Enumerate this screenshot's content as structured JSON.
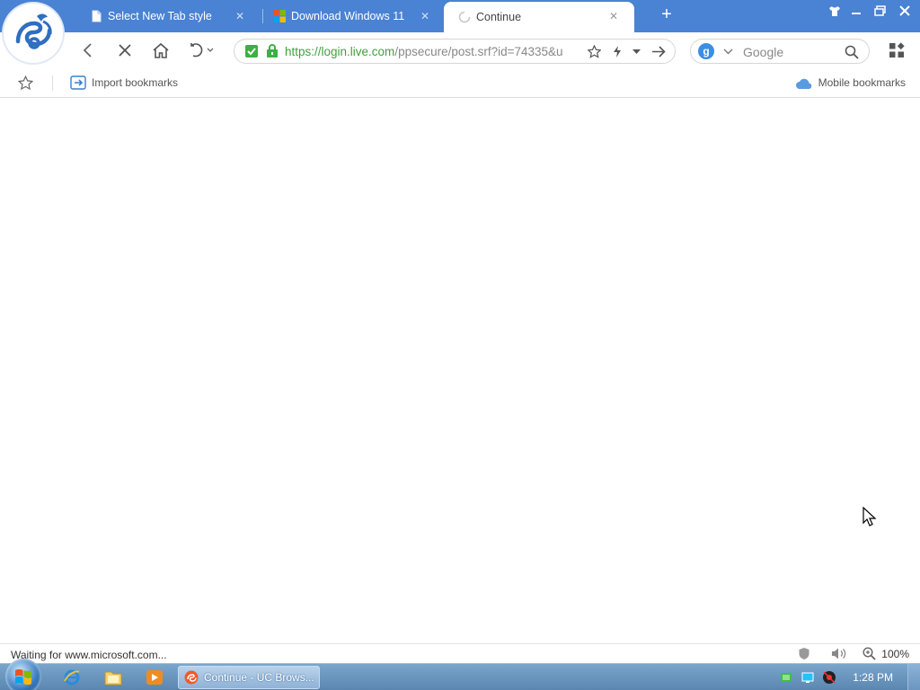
{
  "tabs": [
    {
      "title": "Select New Tab style",
      "icon": "page-icon"
    },
    {
      "title": "Download Windows 11",
      "icon": "windows-logo-icon"
    },
    {
      "title": "Continue",
      "icon": "loading-spinner-icon"
    }
  ],
  "address_bar": {
    "url_host": "https://login.live.com",
    "url_path": "/ppsecure/post.srf?id=74335&u"
  },
  "search": {
    "engine": "g",
    "placeholder": "Google"
  },
  "bookmarks": {
    "import_label": "Import bookmarks",
    "mobile_label": "Mobile bookmarks"
  },
  "status": {
    "text": "Waiting for www.microsoft.com...",
    "zoom": "100%"
  },
  "taskbar": {
    "task_label": "Continue - UC Brows...",
    "clock": "1:28 PM"
  },
  "colors": {
    "accent": "#4a82d4",
    "secure_green": "#3fa13f"
  }
}
